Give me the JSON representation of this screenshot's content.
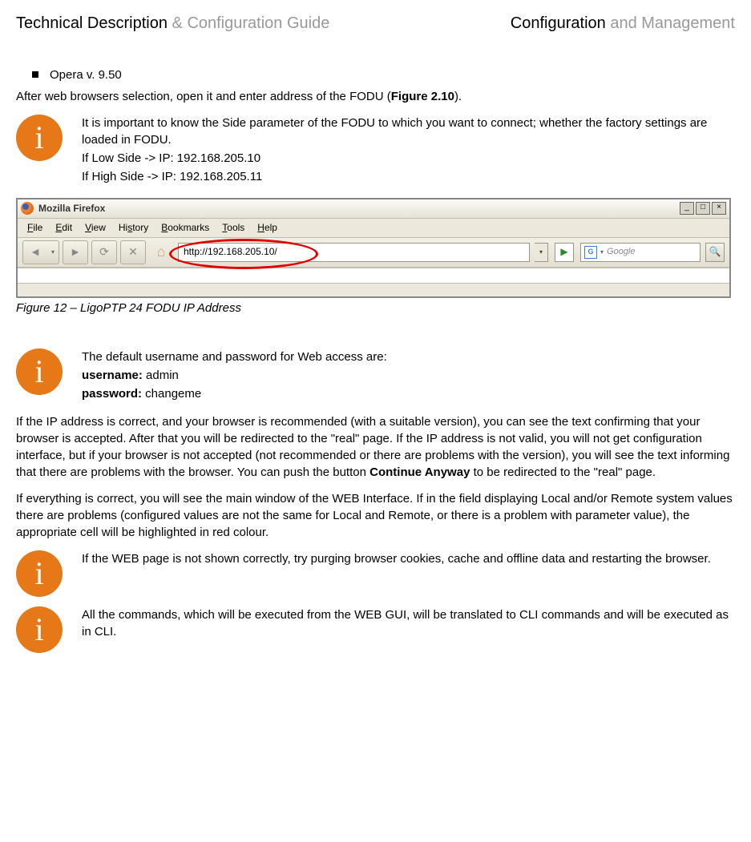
{
  "header": {
    "left_bold": "Technical Description",
    "left_light": " & Configuration Guide",
    "right_bold": "Configuration",
    "right_light": " and Management"
  },
  "bullet": "Opera v. 9.50",
  "intro_text_a": "After web browsers selection, open it and enter address of the FODU (",
  "intro_text_b": "Figure 2.10",
  "intro_text_c": ").",
  "info1": {
    "line1": "It is important to know the Side parameter of the FODU to which you want to connect; whether the factory settings are loaded in FODU.",
    "line2": "If Low Side -> IP: 192.168.205.10",
    "line3": "If High Side -> IP: 192.168.205.11"
  },
  "browser": {
    "title": "Mozilla Firefox",
    "menus": {
      "file": "File",
      "edit": "Edit",
      "view": "View",
      "history": "History",
      "bookmarks": "Bookmarks",
      "tools": "Tools",
      "help": "Help"
    },
    "url": "http://192.168.205.10/",
    "search_engine": "G",
    "search_placeholder": "Google"
  },
  "figure_caption": "Figure 12 – LigoPTP 24 FODU IP Address",
  "info2": {
    "line1": "The default username and password for Web access are:",
    "line2a": "username:",
    "line2b": " admin",
    "line3a": "password:",
    "line3b": " changeme"
  },
  "para1a": "If the IP address is correct, and your browser is recommended (with a suitable version), you can see the text confirming that your browser is accepted. After that you will be redirected to the \"real\" page. If the IP address is not valid, you will not get configuration interface, but if your browser is not accepted (not recommended or there are problems with the version), you will see the text informing that there are problems with the browser. You can push the button ",
  "para1b": "Continue Anyway",
  "para1c": " to be redirected to the \"real\" page.",
  "para2": "If everything is correct, you will see the main window of the WEB Interface. If in the field displaying Local and/or Remote system values there are problems (configured values are not the same for Local and Remote, or there is a problem with parameter value), the appropriate cell will be highlighted in red colour.",
  "info3": "If the WEB page is not shown correctly, try purging browser cookies, cache and offline data and restarting the browser.",
  "info4": "All the commands, which will be executed from the WEB GUI, will be translated to CLI commands and will be executed as in CLI."
}
